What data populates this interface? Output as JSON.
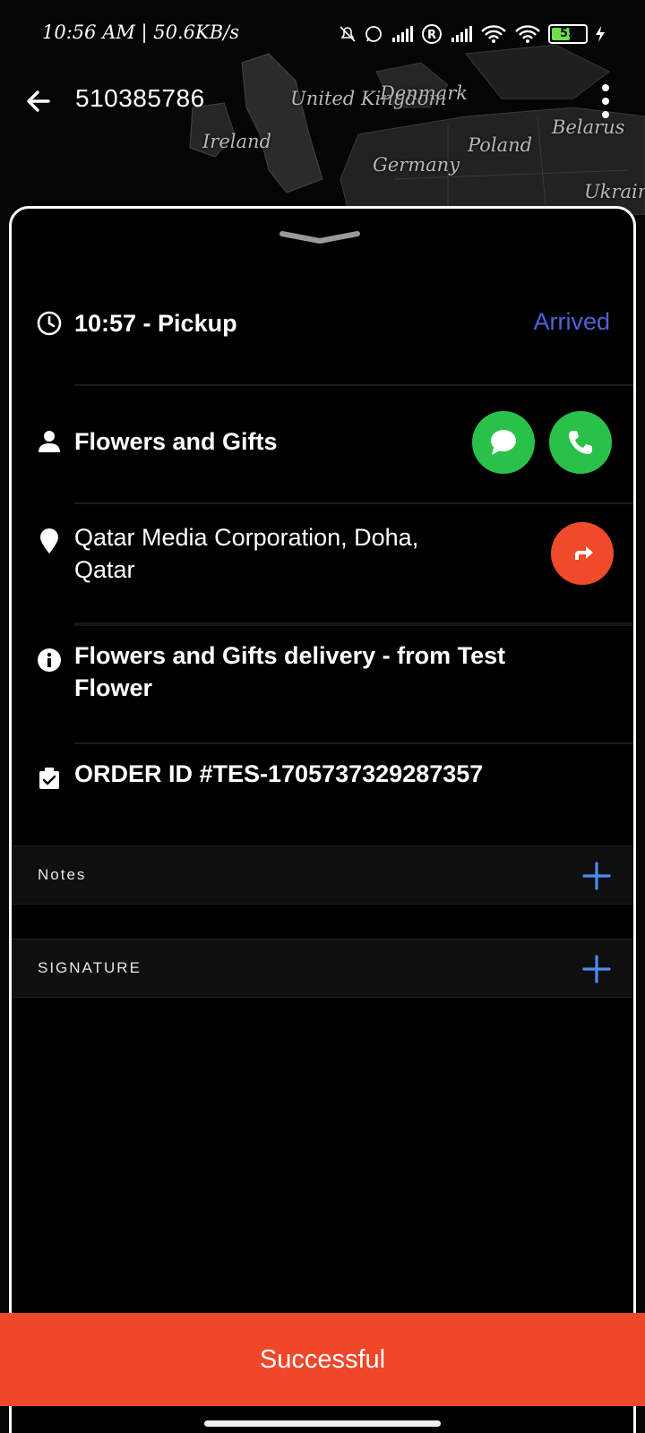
{
  "status_bar": {
    "time_text": "10:56 AM | 50.6KB/s",
    "battery_level": "55",
    "battery_fraction": 0.55,
    "icons": [
      "mute-notifications-icon",
      "whatsapp-icon",
      "signal-icon",
      "roaming-icon",
      "signal-icon",
      "wifi-icon",
      "wifi-icon",
      "battery-icon",
      "charging-icon"
    ]
  },
  "header": {
    "title": "510385786",
    "back_icon": "arrow-left-icon",
    "menu_icon": "more-vertical-icon"
  },
  "map": {
    "labels": [
      "United Kingdom",
      "Denmark",
      "Ireland",
      "Poland",
      "Belarus",
      "Germany",
      "Ukraine"
    ]
  },
  "task": {
    "pickup_text": "10:57 - Pickup",
    "status": "Arrived",
    "customer_name": "Flowers and Gifts",
    "address_line1": "Qatar Media Corporation, Doha,",
    "address_line2": "Qatar",
    "description_line1": "Flowers and Gifts delivery - from Test",
    "description_line2": "Flower",
    "order_id": "ORDER ID #TES-1705737329287357"
  },
  "sections": {
    "notes_label": "Notes",
    "signature_label": "SIGNATURE"
  },
  "footer": {
    "success_label": "Successful"
  },
  "colors": {
    "accent_orange": "#f0472a",
    "status_blue": "#4f63d8",
    "call_green": "#2ac14a",
    "plus_blue": "#4a8ef0"
  }
}
